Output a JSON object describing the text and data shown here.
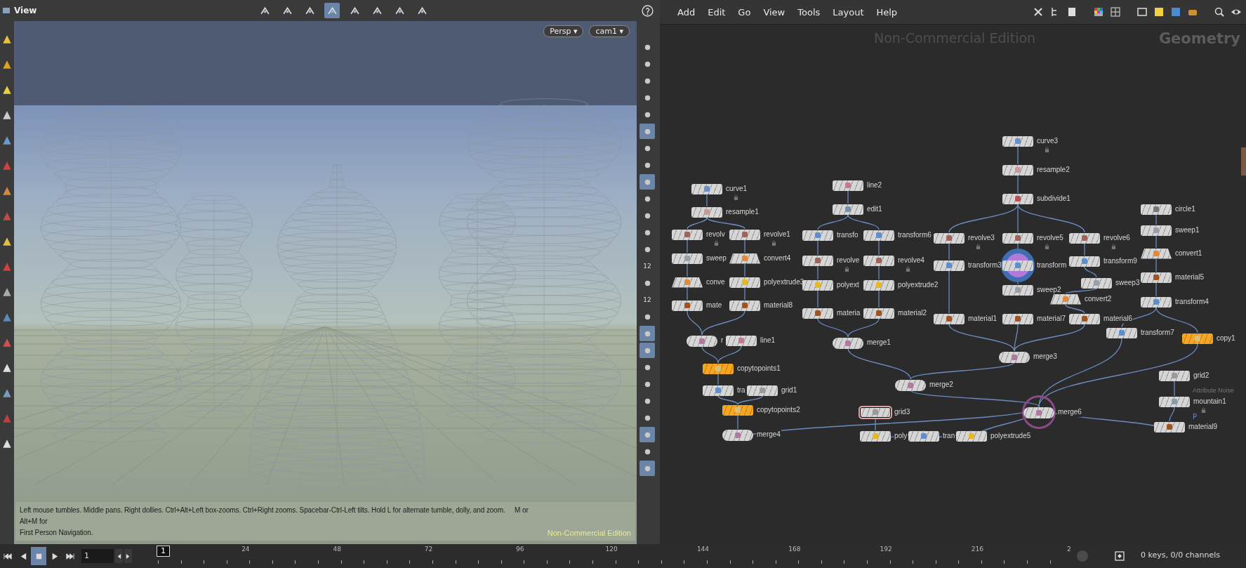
{
  "viewport": {
    "title": "View",
    "camera_buttons": [
      {
        "label": "Persp ▾"
      },
      {
        "label": "cam1 ▾"
      }
    ],
    "help_text": "Left mouse tumbles. Middle pans. Right dollies. Ctrl+Alt+Left box-zooms. Ctrl+Right zooms. Spacebar-Ctrl-Left tilts. Hold L for alternate tumble, dolly, and zoom.     M or Alt+M for\nFirst Person Navigation.",
    "edition_label": "Non-Commercial Edition"
  },
  "view_tools": [
    {
      "selected": false
    },
    {
      "selected": false
    },
    {
      "selected": false
    },
    {
      "selected": true
    },
    {
      "selected": false
    },
    {
      "selected": false
    },
    {
      "selected": false
    },
    {
      "selected": false
    }
  ],
  "right_toolbar": [
    {
      "kind": "icon",
      "selected": false
    },
    {
      "kind": "icon",
      "selected": false
    },
    {
      "kind": "icon",
      "selected": false
    },
    {
      "kind": "icon",
      "selected": false
    },
    {
      "kind": "icon",
      "selected": false
    },
    {
      "kind": "icon",
      "selected": true
    },
    {
      "kind": "icon",
      "selected": false
    },
    {
      "kind": "icon",
      "selected": false
    },
    {
      "kind": "icon",
      "selected": true
    },
    {
      "kind": "icon",
      "selected": false
    },
    {
      "kind": "icon",
      "selected": false
    },
    {
      "kind": "icon",
      "selected": false
    },
    {
      "kind": "icon",
      "selected": false
    },
    {
      "kind": "text",
      "label": "12",
      "selected": false
    },
    {
      "kind": "icon",
      "selected": false
    },
    {
      "kind": "text",
      "label": "12",
      "selected": false
    },
    {
      "kind": "icon",
      "selected": false
    },
    {
      "kind": "icon",
      "selected": true
    },
    {
      "kind": "icon",
      "selected": true
    },
    {
      "kind": "icon",
      "selected": false
    },
    {
      "kind": "icon",
      "selected": false
    },
    {
      "kind": "icon",
      "selected": false
    },
    {
      "kind": "icon",
      "selected": false
    },
    {
      "kind": "icon",
      "selected": true
    },
    {
      "kind": "icon",
      "selected": false
    },
    {
      "kind": "icon",
      "selected": true
    }
  ],
  "network": {
    "menu": [
      "Add",
      "Edit",
      "Go",
      "View",
      "Tools",
      "Layout",
      "Help"
    ],
    "edition_label": "Non-Commercial Edition",
    "context_label": "Geometry",
    "nodes": [
      {
        "label": "curve1",
        "kind": "box",
        "selected": false,
        "locked": true,
        "bypassed": false,
        "current": false,
        "highlighted": false
      },
      {
        "label": "resample1",
        "kind": "box",
        "selected": false,
        "locked": false,
        "bypassed": false,
        "current": false,
        "highlighted": false
      },
      {
        "label": "revolv",
        "kind": "box",
        "selected": false,
        "locked": true,
        "bypassed": false,
        "current": false,
        "highlighted": false
      },
      {
        "label": "revolve1",
        "kind": "box",
        "selected": false,
        "locked": true,
        "bypassed": false,
        "current": false,
        "highlighted": false
      },
      {
        "label": "sweep",
        "kind": "box",
        "selected": false,
        "locked": false,
        "bypassed": false,
        "current": false,
        "highlighted": false
      },
      {
        "label": "convert4",
        "kind": "convert",
        "selected": false,
        "locked": false,
        "bypassed": false,
        "current": false,
        "highlighted": false
      },
      {
        "label": "conve",
        "kind": "convert",
        "selected": false,
        "locked": false,
        "bypassed": false,
        "current": false,
        "highlighted": false
      },
      {
        "label": "polyextrude3",
        "kind": "box",
        "selected": false,
        "locked": false,
        "bypassed": false,
        "current": false,
        "highlighted": false
      },
      {
        "label": "mate",
        "kind": "box",
        "selected": false,
        "locked": false,
        "bypassed": false,
        "current": false,
        "highlighted": false
      },
      {
        "label": "material8",
        "kind": "box",
        "selected": false,
        "locked": false,
        "bypassed": false,
        "current": false,
        "highlighted": false
      },
      {
        "label": "r",
        "kind": "merge",
        "selected": false,
        "locked": false,
        "bypassed": false,
        "current": false,
        "highlighted": false
      },
      {
        "label": "line1",
        "kind": "box",
        "selected": false,
        "locked": false,
        "bypassed": false,
        "current": false,
        "highlighted": false
      },
      {
        "label": "copytopoints1",
        "kind": "box",
        "selected": false,
        "locked": false,
        "bypassed": true,
        "current": false,
        "highlighted": false
      },
      {
        "label": "tra",
        "kind": "box",
        "selected": false,
        "locked": false,
        "bypassed": false,
        "current": false,
        "highlighted": false
      },
      {
        "label": "grid1",
        "kind": "box",
        "selected": false,
        "locked": false,
        "bypassed": false,
        "current": false,
        "highlighted": false
      },
      {
        "label": "copytopoints2",
        "kind": "box",
        "selected": false,
        "locked": false,
        "bypassed": true,
        "current": false,
        "highlighted": false
      },
      {
        "label": "merge4",
        "kind": "merge",
        "selected": false,
        "locked": false,
        "bypassed": false,
        "current": false,
        "highlighted": false
      },
      {
        "label": "line2",
        "kind": "box",
        "selected": false,
        "locked": false,
        "bypassed": false,
        "current": false,
        "highlighted": false
      },
      {
        "label": "edit1",
        "kind": "box",
        "selected": false,
        "locked": false,
        "bypassed": false,
        "current": false,
        "highlighted": false
      },
      {
        "label": "transfo",
        "kind": "box",
        "selected": false,
        "locked": false,
        "bypassed": false,
        "current": false,
        "highlighted": false
      },
      {
        "label": "transform6",
        "kind": "box",
        "selected": false,
        "locked": false,
        "bypassed": false,
        "current": false,
        "highlighted": false
      },
      {
        "label": "revolve",
        "kind": "box",
        "selected": false,
        "locked": true,
        "bypassed": false,
        "current": false,
        "highlighted": false
      },
      {
        "label": "revolve4",
        "kind": "box",
        "selected": false,
        "locked": true,
        "bypassed": false,
        "current": false,
        "highlighted": false
      },
      {
        "label": "polyext",
        "kind": "box",
        "selected": false,
        "locked": false,
        "bypassed": false,
        "current": false,
        "highlighted": false
      },
      {
        "label": "polyextrude2",
        "kind": "box",
        "selected": false,
        "locked": false,
        "bypassed": false,
        "current": false,
        "highlighted": false
      },
      {
        "label": "materia",
        "kind": "box",
        "selected": false,
        "locked": false,
        "bypassed": false,
        "current": false,
        "highlighted": false
      },
      {
        "label": "material2",
        "kind": "box",
        "selected": false,
        "locked": false,
        "bypassed": false,
        "current": false,
        "highlighted": false
      },
      {
        "label": "merge1",
        "kind": "merge",
        "selected": false,
        "locked": false,
        "bypassed": false,
        "current": false,
        "highlighted": false
      },
      {
        "label": "merge2",
        "kind": "merge",
        "selected": false,
        "locked": false,
        "bypassed": false,
        "current": false,
        "highlighted": false
      },
      {
        "label": "grid3",
        "kind": "box",
        "selected": true,
        "locked": false,
        "bypassed": false,
        "current": false,
        "highlighted": false
      },
      {
        "label": "poly",
        "kind": "box",
        "selected": false,
        "locked": false,
        "bypassed": false,
        "current": false,
        "highlighted": false
      },
      {
        "label": "tran",
        "kind": "box",
        "selected": false,
        "locked": false,
        "bypassed": false,
        "current": false,
        "highlighted": false
      },
      {
        "label": "polyextrude5",
        "kind": "box",
        "selected": false,
        "locked": false,
        "bypassed": false,
        "current": false,
        "highlighted": false
      },
      {
        "label": "curve3",
        "kind": "box",
        "selected": false,
        "locked": true,
        "bypassed": false,
        "current": false,
        "highlighted": false
      },
      {
        "label": "resample2",
        "kind": "box",
        "selected": false,
        "locked": false,
        "bypassed": false,
        "current": false,
        "highlighted": false
      },
      {
        "label": "subdivide1",
        "kind": "box",
        "selected": false,
        "locked": false,
        "bypassed": false,
        "current": false,
        "highlighted": false
      },
      {
        "label": "revolve3",
        "kind": "box",
        "selected": false,
        "locked": true,
        "bypassed": false,
        "current": false,
        "highlighted": false
      },
      {
        "label": "revolve5",
        "kind": "box",
        "selected": false,
        "locked": true,
        "bypassed": false,
        "current": false,
        "highlighted": false
      },
      {
        "label": "revolve6",
        "kind": "box",
        "selected": false,
        "locked": true,
        "bypassed": false,
        "current": false,
        "highlighted": false
      },
      {
        "label": "transform3",
        "kind": "box",
        "selected": false,
        "locked": false,
        "bypassed": false,
        "current": false,
        "highlighted": false
      },
      {
        "label": "transform",
        "kind": "box",
        "selected": false,
        "locked": false,
        "bypassed": false,
        "current": true,
        "highlighted": false
      },
      {
        "label": "transform9",
        "kind": "box",
        "selected": false,
        "locked": false,
        "bypassed": false,
        "current": false,
        "highlighted": false
      },
      {
        "label": "sweep2",
        "kind": "box",
        "selected": false,
        "locked": false,
        "bypassed": false,
        "current": false,
        "highlighted": false
      },
      {
        "label": "sweep3",
        "kind": "box",
        "selected": false,
        "locked": false,
        "bypassed": false,
        "current": false,
        "highlighted": false
      },
      {
        "label": "convert2",
        "kind": "convert",
        "selected": false,
        "locked": false,
        "bypassed": false,
        "current": false,
        "highlighted": false
      },
      {
        "label": "material1",
        "kind": "box",
        "selected": false,
        "locked": false,
        "bypassed": false,
        "current": false,
        "highlighted": false
      },
      {
        "label": "material7",
        "kind": "box",
        "selected": false,
        "locked": false,
        "bypassed": false,
        "current": false,
        "highlighted": false
      },
      {
        "label": "material6",
        "kind": "box",
        "selected": false,
        "locked": false,
        "bypassed": false,
        "current": false,
        "highlighted": false
      },
      {
        "label": "merge3",
        "kind": "merge",
        "selected": false,
        "locked": false,
        "bypassed": false,
        "current": false,
        "highlighted": false
      },
      {
        "label": "merge6",
        "kind": "merge",
        "selected": false,
        "locked": false,
        "bypassed": false,
        "current": false,
        "highlighted": true
      },
      {
        "label": "circle1",
        "kind": "box",
        "selected": false,
        "locked": false,
        "bypassed": false,
        "current": false,
        "highlighted": false
      },
      {
        "label": "sweep1",
        "kind": "box",
        "selected": false,
        "locked": false,
        "bypassed": false,
        "current": false,
        "highlighted": false
      },
      {
        "label": "convert1",
        "kind": "convert",
        "selected": false,
        "locked": false,
        "bypassed": false,
        "current": false,
        "highlighted": false
      },
      {
        "label": "material5",
        "kind": "box",
        "selected": false,
        "locked": false,
        "bypassed": false,
        "current": false,
        "highlighted": false
      },
      {
        "label": "transform4",
        "kind": "box",
        "selected": false,
        "locked": false,
        "bypassed": false,
        "current": false,
        "highlighted": false
      },
      {
        "label": "transform7",
        "kind": "box",
        "selected": false,
        "locked": false,
        "bypassed": false,
        "current": false,
        "highlighted": false
      },
      {
        "label": "copy1",
        "kind": "box",
        "selected": false,
        "locked": false,
        "bypassed": true,
        "current": false,
        "highlighted": false
      },
      {
        "label": "grid2",
        "kind": "box",
        "selected": false,
        "locked": false,
        "bypassed": false,
        "current": false,
        "highlighted": false
      },
      {
        "label": "mountain1",
        "kind": "box",
        "selected": false,
        "locked": true,
        "bypassed": false,
        "current": false,
        "highlighted": false,
        "comment": "Attribute Noise",
        "tag": "P"
      },
      {
        "label": "material9",
        "kind": "box",
        "selected": false,
        "locked": false,
        "bypassed": false,
        "current": false,
        "highlighted": false
      }
    ]
  },
  "timeline": {
    "playback": [
      {
        "selected": false
      },
      {
        "selected": false
      },
      {
        "selected": true
      },
      {
        "selected": false
      },
      {
        "selected": false
      }
    ],
    "frame": "1",
    "current_marker": "1",
    "tick_labels": [
      "24",
      "48",
      "72",
      "96",
      "120",
      "144",
      "168",
      "192",
      "216",
      "2"
    ],
    "keys_status": "0 keys, 0/0 channels"
  }
}
